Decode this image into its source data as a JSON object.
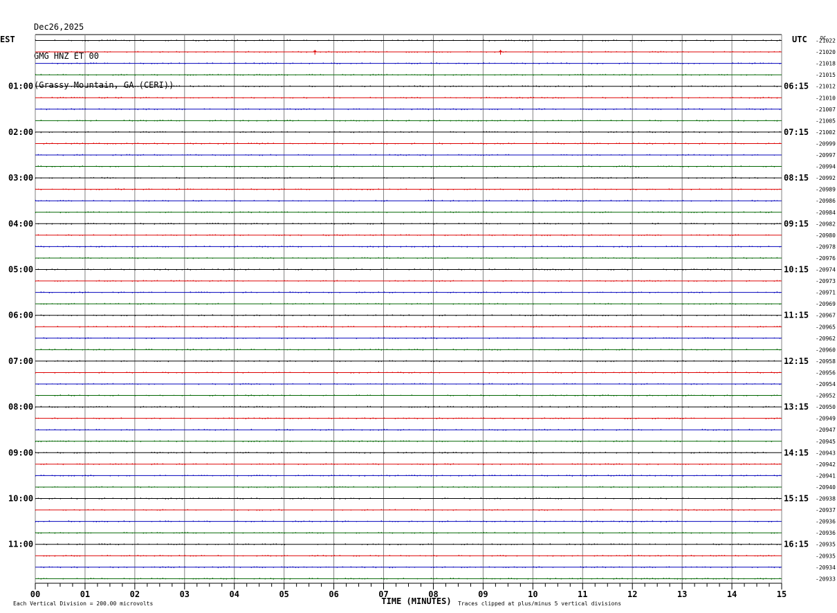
{
  "header": {
    "date": "Dec26,2025",
    "station": "GMG HNZ ET 00",
    "location": "(Grassy Mountain, GA (CERI))"
  },
  "left_zone": "EST",
  "right_zone": "UTC",
  "dc_label": "DC",
  "chart_data": {
    "type": "line",
    "title": "GMG HNZ ET 00",
    "xlabel": "TIME (MINUTES)",
    "xlim": [
      0,
      15
    ],
    "x_ticks": [
      "00",
      "01",
      "02",
      "03",
      "04",
      "05",
      "06",
      "07",
      "08",
      "09",
      "10",
      "11",
      "12",
      "13",
      "14",
      "15"
    ],
    "rows": 48,
    "row_colors": [
      "#000000",
      "#dd0000",
      "#0000bb",
      "#006600"
    ],
    "left_hour_labels": [
      "01:00",
      "02:00",
      "03:00",
      "04:00",
      "05:00",
      "06:00",
      "07:00",
      "08:00",
      "09:00",
      "10:00",
      "11:00"
    ],
    "right_hour_labels": [
      "06:15",
      "07:15",
      "08:15",
      "09:15",
      "10:15",
      "11:15",
      "12:15",
      "13:15",
      "14:15",
      "15:15",
      "16:15"
    ],
    "dc_offsets": [
      "-21022",
      "-21020",
      "-21018",
      "-21015",
      "-21012",
      "-21010",
      "-21007",
      "-21005",
      "-21002",
      "-20999",
      "-20997",
      "-20994",
      "-20992",
      "-20989",
      "-20986",
      "-20984",
      "-20982",
      "-20980",
      "-20978",
      "-20976",
      "-20974",
      "-20973",
      "-20971",
      "-20969",
      "-20967",
      "-20965",
      "-20962",
      "-20960",
      "-20958",
      "-20956",
      "-20954",
      "-20952",
      "-20950",
      "-20949",
      "-20947",
      "-20945",
      "-20943",
      "-20942",
      "-20941",
      "-20940",
      "-20938",
      "-20937",
      "-20936",
      "-20936",
      "-20935",
      "-20935",
      "-20934",
      "-20933"
    ],
    "events": [
      {
        "row": 1,
        "minute": 9.35
      },
      {
        "row": 1,
        "minute": 5.62
      }
    ]
  },
  "footer": {
    "scale_note": "Each Vertical Division =  200.00 microvolts",
    "clip_note": "Traces clipped at plus/minus 5 vertical divisions"
  }
}
